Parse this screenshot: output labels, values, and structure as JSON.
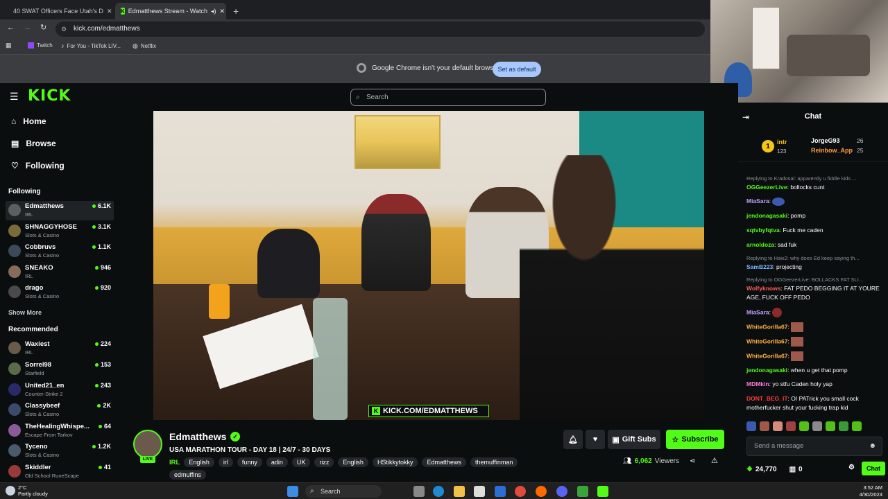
{
  "browser": {
    "tabs": [
      {
        "title": "40 SWAT Officers Face Utah's D",
        "icon": "youtube-icon"
      },
      {
        "title": "Edmatthews Stream - Watch",
        "icon": "kick-icon"
      }
    ],
    "url": "kick.com/edmatthews",
    "bookmarks": [
      "Twitch",
      "For You - TikTok LIV...",
      "Netflix"
    ],
    "default_msg": "Google Chrome isn't your default browser",
    "set_default": "Set as default"
  },
  "kick": {
    "logo": "KICK",
    "search_placeholder": "Search"
  },
  "sidebar": {
    "nav": [
      {
        "label": "Home",
        "icon": "home-icon"
      },
      {
        "label": "Browse",
        "icon": "browse-icon"
      },
      {
        "label": "Following",
        "icon": "heart-icon"
      }
    ],
    "following_title": "Following",
    "following": [
      {
        "name": "Edmatthews",
        "category": "IRL",
        "viewers": "6.1K"
      },
      {
        "name": "SHNAGGYHOSE",
        "category": "Slots & Casino",
        "viewers": "3.1K"
      },
      {
        "name": "Cobbruvs",
        "category": "Slots & Casino",
        "viewers": "1.1K"
      },
      {
        "name": "SNEAKO",
        "category": "IRL",
        "viewers": "946"
      },
      {
        "name": "drago",
        "category": "Slots & Casino",
        "viewers": "920"
      }
    ],
    "show_more": "Show More",
    "recommended_title": "Recommended",
    "recommended": [
      {
        "name": "Waxiest",
        "category": "IRL",
        "viewers": "224"
      },
      {
        "name": "Sorrel98",
        "category": "Starfield",
        "viewers": "153"
      },
      {
        "name": "United21_en",
        "category": "Counter-Strike 2",
        "viewers": "243"
      },
      {
        "name": "Classybeef",
        "category": "Slots & Casino",
        "viewers": "2K"
      },
      {
        "name": "TheHealingWhispe...",
        "category": "Escape From Tarkov",
        "viewers": "64"
      },
      {
        "name": "Tyceno",
        "category": "Slots & Casino",
        "viewers": "1.2K"
      },
      {
        "name": "Skiddler",
        "category": "Old School RuneScape",
        "viewers": "41"
      }
    ]
  },
  "video": {
    "watermark": "KICK.COM/EDMATTHEWS"
  },
  "stream": {
    "streamer": "Edmatthews",
    "live": "LIVE",
    "title": "USA MARATHON TOUR - DAY 18 | 24/7 - 30 DAYS",
    "category": "IRL",
    "tags": [
      "English",
      "irl",
      "funny",
      "adin",
      "UK",
      "rizz",
      "English",
      "HStikkytokky",
      "Edmatthews",
      "themuffinman",
      "edmuffins"
    ],
    "gift_subs": "Gift Subs",
    "subscribe": "Subscribe",
    "viewers": "6,062",
    "viewers_label": "Viewers"
  },
  "chat": {
    "title": "Chat",
    "leaderboard": [
      {
        "name": "intr",
        "value": "123"
      },
      {
        "name": "JorgeG93",
        "value": "26"
      },
      {
        "name": "Reinbow_App",
        "value": "25"
      }
    ],
    "messages": [
      {
        "reply": "Replying to Kradosal: apparently u fiddle kids ...",
        "user": "OGGeezerLive",
        "text": "bollocks cunt",
        "color": "#53fc18"
      },
      {
        "user": "MiaSara",
        "text": "",
        "color": "#bfa3ff"
      },
      {
        "user": "jendonagasaki",
        "text": "pomp",
        "color": "#53fc18"
      },
      {
        "user": "sqtvbyfqtva",
        "text": "Fuck me caden",
        "color": "#53fc18"
      },
      {
        "user": "arnoldoza",
        "text": "sad fuk",
        "color": "#53fc18"
      },
      {
        "reply": "Replying to Haix2: why does Ed keep saying th...",
        "user": "SamB223",
        "text": "projecting",
        "color": "#7ab7ff"
      },
      {
        "reply": "Replying to OGGeezerLive: BOLLACKS FAT SLI...",
        "user": "Wolfyknows",
        "text": "FAT PEDO BEGGING IT AT YOURE AGE, FUCK OFF PEDO",
        "color": "#ff5c5c"
      },
      {
        "user": "MiaSara",
        "text": "",
        "color": "#bfa3ff"
      },
      {
        "user": "WhiteGorilla67",
        "text": "",
        "color": "#ffb347"
      },
      {
        "user": "WhiteGorilla67",
        "text": "",
        "color": "#ffb347"
      },
      {
        "user": "WhiteGorilla67",
        "text": "",
        "color": "#ffb347"
      },
      {
        "user": "jendonagasaki",
        "text": "when u get that pomp",
        "color": "#53fc18"
      },
      {
        "user": "MDMkin",
        "text": "yo stfu Caden holy yap",
        "color": "#ff7ad9"
      },
      {
        "user": "DONT_BEG_IT",
        "text": "OI PATrick you small cock motherfucker shut your fucking trap kid",
        "color": "#ff3b3b"
      }
    ],
    "input_placeholder": "Send a message",
    "points": "24,770",
    "bag_count": "0",
    "chat_button": "Chat"
  },
  "taskbar": {
    "temp": "2°C",
    "weather": "Partly cloudy",
    "search": "Search",
    "time": "3:52 AM",
    "date": "4/30/2024"
  }
}
